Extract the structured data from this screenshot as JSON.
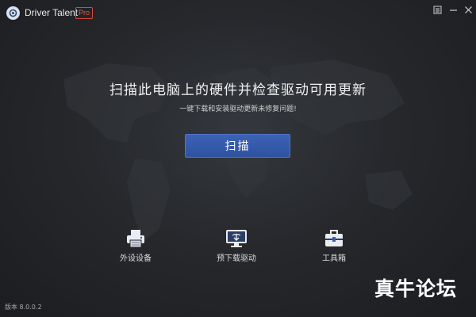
{
  "window": {
    "app_title": "Driver Talent",
    "edition_badge": "Pro",
    "controls": {
      "menu_icon": "menu-icon",
      "minimize_icon": "minimize-icon",
      "close_icon": "close-icon"
    }
  },
  "main": {
    "headline": "扫描此电脑上的硬件并检查驱动可用更新",
    "subline": "一键下载和安装驱动更新未修复问题!",
    "scan_button_label": "扫描"
  },
  "tools": [
    {
      "label": "外设设备",
      "icon": "printer-icon"
    },
    {
      "label": "预下载驱动",
      "icon": "monitor-download-icon"
    },
    {
      "label": "工具箱",
      "icon": "toolbox-icon"
    }
  ],
  "footer": {
    "version": "版本 8.0.0.2"
  },
  "overlay": {
    "watermark": "真牛论坛"
  },
  "colors": {
    "background": "#26282c",
    "accent_button": "#3558a8",
    "badge": "#d84a3a"
  }
}
